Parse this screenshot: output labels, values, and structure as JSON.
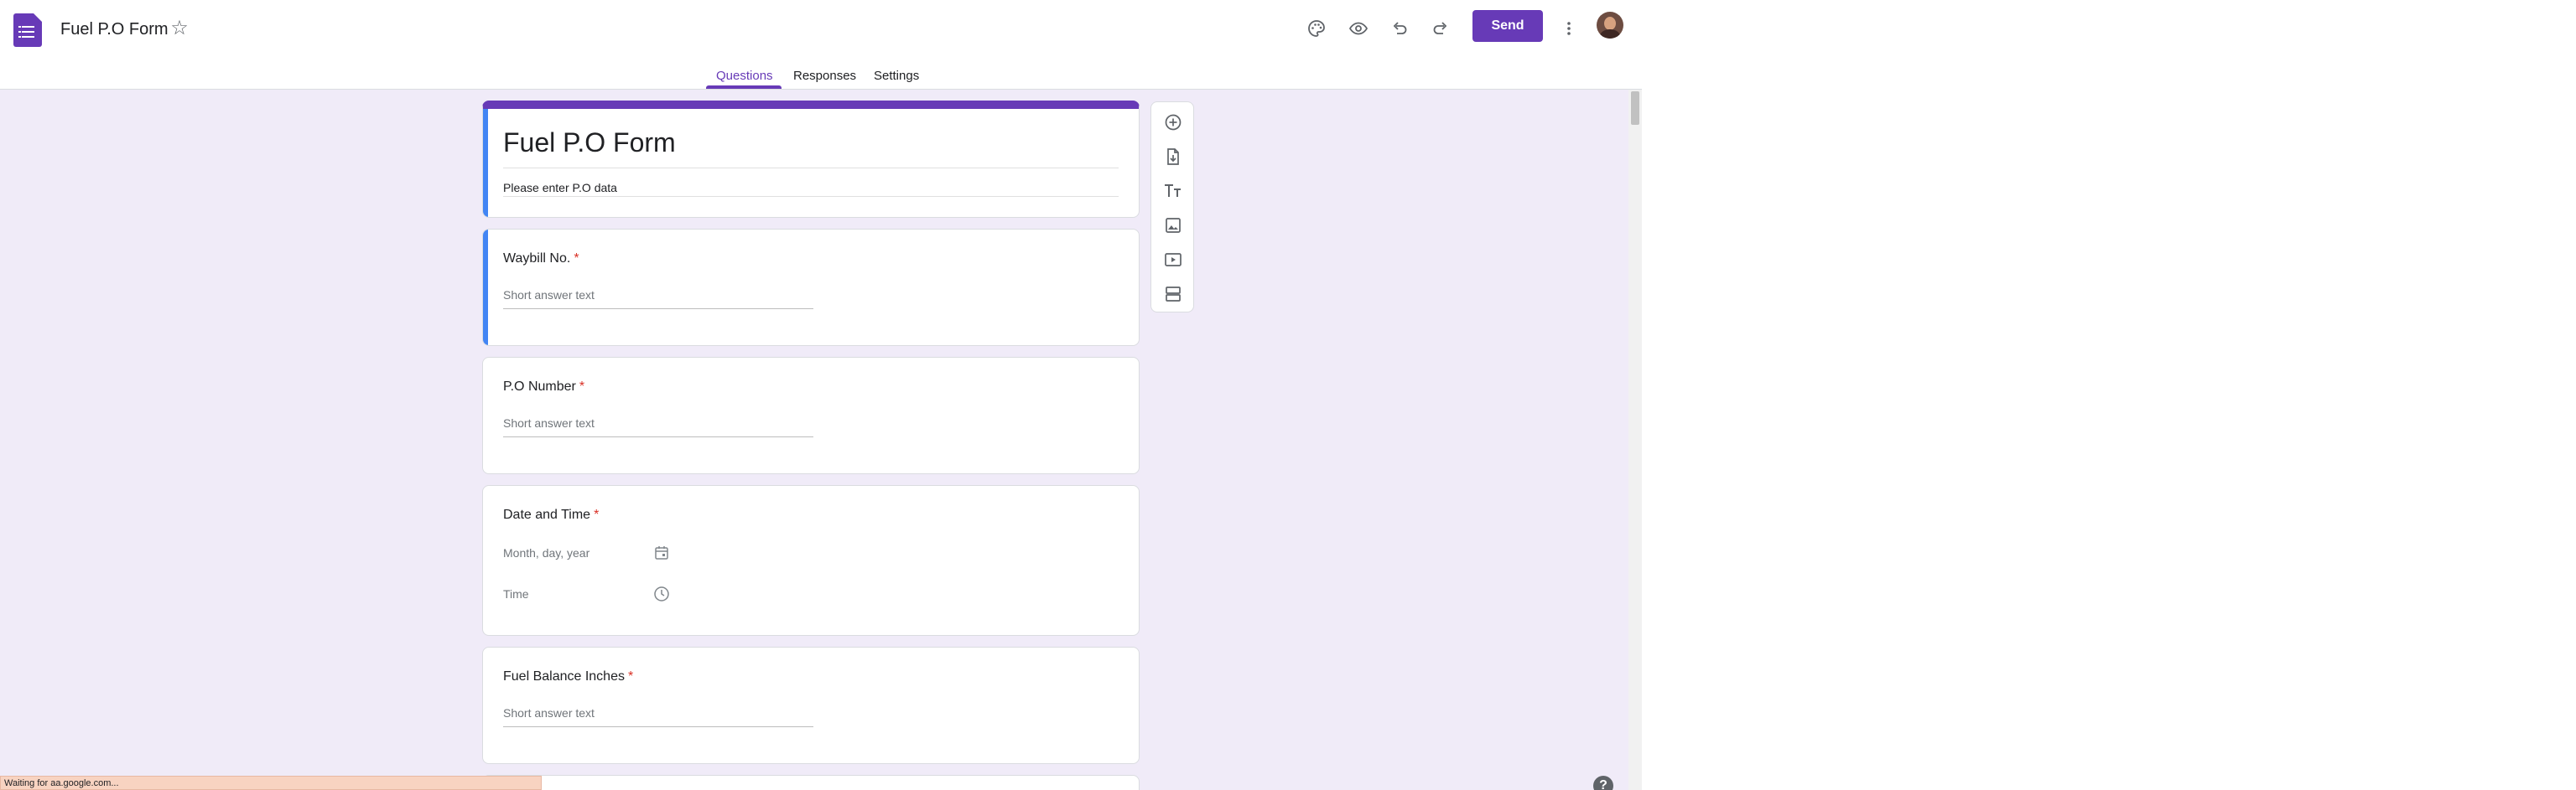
{
  "header": {
    "title": "Fuel P.O Form",
    "send_label": "Send",
    "accent": "#673ab7"
  },
  "tabs": [
    "Questions",
    "Responses",
    "Settings"
  ],
  "form": {
    "title": "Fuel P.O Form",
    "description": "Please enter P.O data"
  },
  "questions": [
    {
      "title": "Waybill No.",
      "required": "*",
      "placeholder": "Short answer text"
    },
    {
      "title": "P.O Number",
      "required": "*",
      "placeholder": "Short answer text"
    },
    {
      "title": "Date and Time",
      "required": "*",
      "date_placeholder": "Month, day, year",
      "time_placeholder": "Time"
    },
    {
      "title": "Fuel Balance Inches",
      "required": "*",
      "placeholder": "Short answer text"
    }
  ],
  "toolbar_icons": [
    "add-question-icon",
    "import-questions-icon",
    "add-title-icon",
    "add-image-icon",
    "add-video-icon",
    "add-section-icon"
  ],
  "status_text": "Waiting for aa.google.com...",
  "help_label": "?"
}
